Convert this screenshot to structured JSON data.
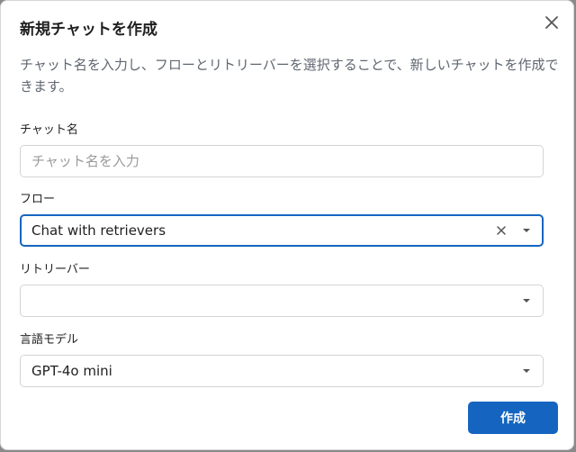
{
  "dialog": {
    "title": "新規チャットを作成",
    "description": "チャット名を入力し、フローとリトリーバーを選択することで、新しいチャットを作成できます。"
  },
  "fields": {
    "chat_name": {
      "label": "チャット名",
      "value": "",
      "placeholder": "チャット名を入力"
    },
    "flow": {
      "label": "フロー",
      "value": "Chat with retrievers"
    },
    "retriever": {
      "label": "リトリーバー",
      "value": ""
    },
    "language_model": {
      "label": "言語モデル",
      "value": "GPT-4o mini"
    }
  },
  "actions": {
    "create_label": "作成"
  },
  "icons": {
    "close": "close-icon",
    "clear": "clear-icon",
    "dropdown": "chevron-down-icon"
  },
  "colors": {
    "primary": "#1565c0",
    "focus_border": "#1565c0",
    "text": "#1f1f1f",
    "muted_text": "#606770"
  }
}
